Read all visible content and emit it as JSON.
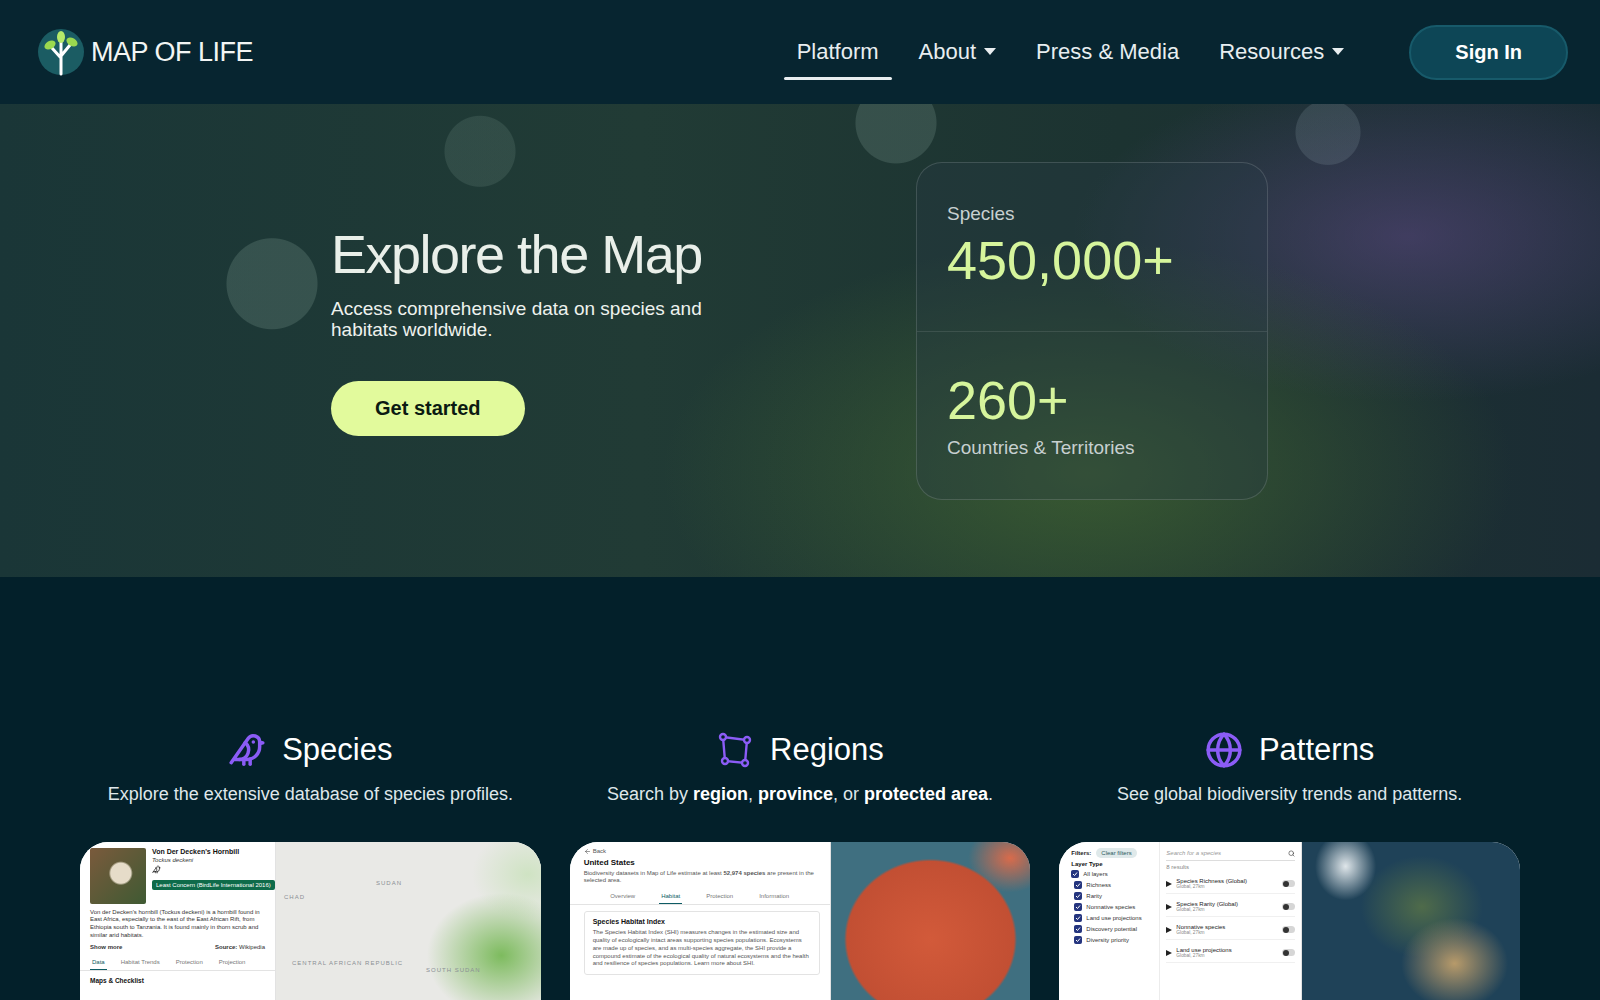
{
  "logo": {
    "text": "MAP OF LIFE"
  },
  "nav": [
    {
      "label": "Platform",
      "selected": true,
      "dropdown": false
    },
    {
      "label": "About",
      "selected": false,
      "dropdown": true
    },
    {
      "label": "Press & Media",
      "selected": false,
      "dropdown": false
    },
    {
      "label": "Resources",
      "selected": false,
      "dropdown": true
    }
  ],
  "sign_in": "Sign In",
  "hero": {
    "title": "Explore the Map",
    "subtitle": "Access comprehensive data on species and habitats worldwide.",
    "button": "Get started",
    "stats": [
      {
        "label": "Species",
        "value": "450,000+",
        "kind": "label-top"
      },
      {
        "label": "Countries & Territories",
        "value": "260+",
        "kind": "label-bottom"
      }
    ]
  },
  "features": [
    {
      "kind": "species",
      "title": "Species",
      "description": [
        {
          "text": "Explore the extensive database of species profiles.",
          "bold": false
        }
      ],
      "preview": {
        "name": "Von Der Decken's Hornbill",
        "latin": "Tockus deckeni",
        "status": "Least Concern (BirdLife International 2016)",
        "text": "Von der Decken's hornbill (Tockus deckeni) is a hornbill found in East Africa, especially to the east of the East African Rift, from Ethiopia south to Tanzania. It is found mainly in thorn scrub and similar arid habitats.",
        "more": "Show more",
        "source_label": "Source:",
        "source": "Wikipedia",
        "tabs": [
          {
            "label": "Data",
            "selected": true
          },
          {
            "label": "Habitat Trends",
            "selected": false
          },
          {
            "label": "Protection",
            "selected": false
          },
          {
            "label": "Projection",
            "selected": false
          }
        ],
        "section": "Maps & Checklist",
        "map_labels": [
          "SUDAN",
          "CHAD",
          "SOUTH SUDAN",
          "CENTRAL AFRICAN REPUBLIC"
        ]
      }
    },
    {
      "kind": "regions",
      "title": "Regions",
      "description": [
        {
          "text": "Search by ",
          "bold": false
        },
        {
          "text": "region",
          "bold": true
        },
        {
          "text": ", ",
          "bold": false
        },
        {
          "text": "province",
          "bold": true
        },
        {
          "text": ", or ",
          "bold": false
        },
        {
          "text": "protected area",
          "bold": true
        },
        {
          "text": ".",
          "bold": false
        }
      ],
      "preview": {
        "back": "Back",
        "title": "United States",
        "intro": [
          {
            "text": "Biodiversity datasets in Map of Life estimate at least ",
            "bold": false
          },
          {
            "text": "52,974 species",
            "bold": true
          },
          {
            "text": " are present in the selected area.",
            "bold": false
          }
        ],
        "tabs": [
          {
            "label": "Overview",
            "selected": false
          },
          {
            "label": "Habitat",
            "selected": true
          },
          {
            "label": "Protection",
            "selected": false
          },
          {
            "label": "Information",
            "selected": false
          }
        ],
        "section": "Species Habitat Index",
        "text": "The Species Habitat Index (SHI) measures changes in the estimated size and quality of ecologically intact areas supporting species populations. Ecosystems are made up of species, and as multi-species aggregate, the SHI provide a compound estimate of the ecological quality of natural ecosystems and the health and resilience of species populations. Learn more about SHI."
      }
    },
    {
      "kind": "patterns",
      "title": "Patterns",
      "description": [
        {
          "text": "See global biodiversity trends and patterns.",
          "bold": false
        }
      ],
      "preview": {
        "filters": "Filters:",
        "clear": "Clear filters",
        "search_placeholder": "Search for a species",
        "results": "8 results",
        "group": "Layer Type",
        "all": {
          "label": "All layers",
          "checked": true
        },
        "options": [
          {
            "label": "Richness",
            "checked": true
          },
          {
            "label": "Rarity",
            "checked": true
          },
          {
            "label": "Nonnative species",
            "checked": true
          },
          {
            "label": "Land use projections",
            "checked": true
          },
          {
            "label": "Discovery potential",
            "checked": true
          },
          {
            "label": "Diversity priority",
            "checked": true
          }
        ],
        "layers": [
          {
            "name": "Species Richness (Global)",
            "meta": "Global, 27km",
            "on": false
          },
          {
            "name": "Species Rarity (Global)",
            "meta": "Global, 27km",
            "on": false
          },
          {
            "name": "Nonnative species",
            "meta": "Global, 27km",
            "on": false
          },
          {
            "name": "Land use projections",
            "meta": "Global, 27km",
            "on": false
          }
        ]
      }
    }
  ]
}
